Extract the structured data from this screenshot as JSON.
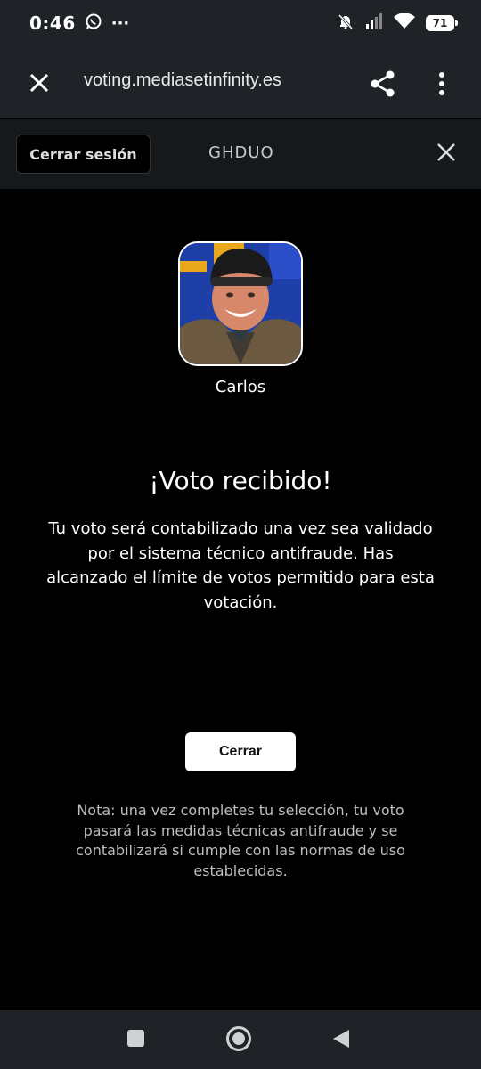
{
  "status_bar": {
    "time": "0:46",
    "dots": "···",
    "battery": "71",
    "icons": [
      "whatsapp-icon",
      "bell-off-icon",
      "signal-icon",
      "wifi-icon",
      "battery-icon"
    ]
  },
  "browser": {
    "url": "voting.mediasetinfinity.es",
    "icons": [
      "close-icon",
      "share-icon",
      "kebab-menu-icon"
    ]
  },
  "site_header": {
    "logout_label": "Cerrar sesión",
    "code": "GHDUO"
  },
  "candidate": {
    "name": "Carlos"
  },
  "result": {
    "title": "¡Voto recibido!",
    "message": "Tu voto será contabilizado una vez sea validado por el sistema técnico antifraude. Has alcanzado el límite de votos permitido para esta votación.",
    "close_label": "Cerrar",
    "note": "Nota: una vez completes tu selección, tu voto pasará las medidas técnicas antifraude y se contabilizará si cumple con las normas de uso establecidas."
  },
  "colors": {
    "background": "#000000",
    "bars": "#1f2327",
    "button": "#ffffff"
  }
}
